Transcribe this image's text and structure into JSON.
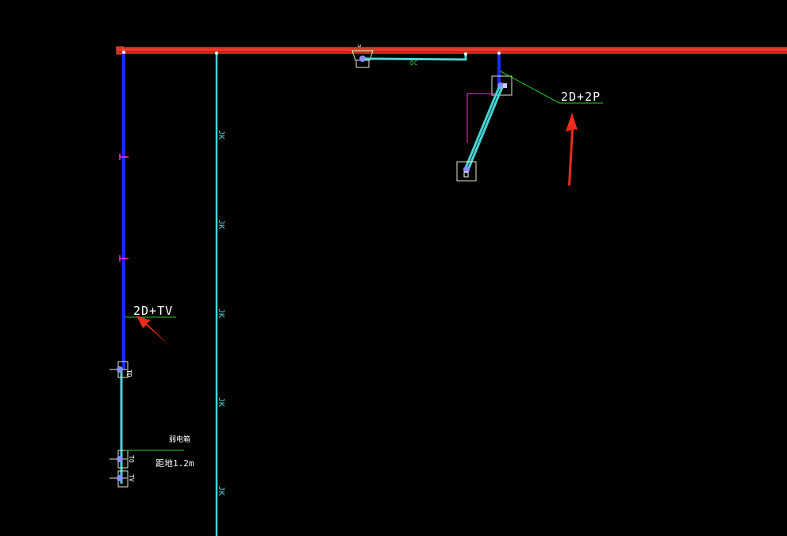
{
  "colors": {
    "background": "#000000",
    "main_pipe": "#c8261a",
    "main_pipe_highlight": "#e0402c",
    "blue_conduit": "#1a2cff",
    "cyan_conduit": "#49d3d3",
    "leader_line": "#27d127",
    "label_text": "#ffffff",
    "arrow": "#ee2a1e",
    "magenta": "#ff33cc",
    "node": "#8b8cff",
    "box": "#e8e8c8"
  },
  "labels": {
    "left_callout": "2D+TV",
    "right_callout": "2D+2P",
    "bottom_upper": "弱电箱",
    "bottom_lower": "距地1.2m",
    "pipe_tag": "DC",
    "cable_mark": "JK",
    "node_tag_top": "TD",
    "node_tag_bottom": "TV",
    "node_tag_mid": "TO"
  },
  "icons": {
    "left_arrow": "red-arrow-icon",
    "right_arrow": "red-arrow-icon"
  }
}
